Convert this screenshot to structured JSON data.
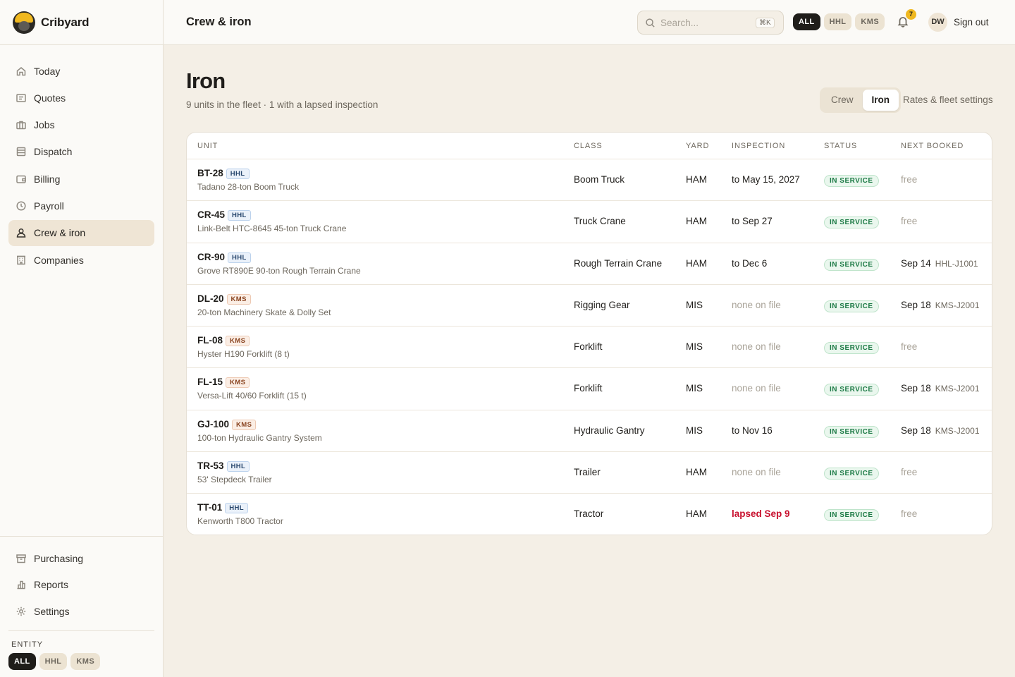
{
  "app": {
    "name": "Cribyard"
  },
  "sidebar": {
    "items": [
      {
        "label": "Today",
        "icon": "home-icon"
      },
      {
        "label": "Quotes",
        "icon": "document-icon"
      },
      {
        "label": "Jobs",
        "icon": "briefcase-icon"
      },
      {
        "label": "Dispatch",
        "icon": "clipboard-icon"
      },
      {
        "label": "Billing",
        "icon": "wallet-icon"
      },
      {
        "label": "Payroll",
        "icon": "clock-icon"
      },
      {
        "label": "Crew & iron",
        "icon": "person-icon",
        "active": true
      },
      {
        "label": "Companies",
        "icon": "building-icon"
      }
    ],
    "bottom_items": [
      {
        "label": "Purchasing",
        "icon": "archive-icon"
      },
      {
        "label": "Reports",
        "icon": "bar-chart-icon"
      },
      {
        "label": "Settings",
        "icon": "gear-icon"
      }
    ],
    "entity_label": "ENTITY",
    "entity_pills": [
      "ALL",
      "HHL",
      "KMS"
    ]
  },
  "header": {
    "title": "Crew & iron",
    "search_placeholder": "Search...",
    "search_shortcut": "⌘K",
    "entity_pills": [
      "ALL",
      "HHL",
      "KMS"
    ],
    "notification_count": "7",
    "avatar_initials": "DW",
    "sign_out": "Sign out"
  },
  "main": {
    "title": "Iron",
    "subtitle": "9 units in the fleet · 1 with a lapsed inspection",
    "tabs": [
      "Crew",
      "Iron"
    ],
    "active_tab": "Iron",
    "settings_link": "Rates & fleet settings"
  },
  "table": {
    "columns": [
      "UNIT",
      "CLASS",
      "YARD",
      "INSPECTION",
      "STATUS",
      "NEXT BOOKED"
    ],
    "rows": [
      {
        "code": "BT-28",
        "entity": "HHL",
        "desc": "Tadano 28-ton Boom Truck",
        "class": "Boom Truck",
        "yard": "HAM",
        "inspection": "to May 15, 2027",
        "inspection_state": "ok",
        "status": "IN SERVICE",
        "next_date": "free",
        "next_job": ""
      },
      {
        "code": "CR-45",
        "entity": "HHL",
        "desc": "Link-Belt HTC-8645 45-ton Truck Crane",
        "class": "Truck Crane",
        "yard": "HAM",
        "inspection": "to Sep 27",
        "inspection_state": "ok",
        "status": "IN SERVICE",
        "next_date": "free",
        "next_job": ""
      },
      {
        "code": "CR-90",
        "entity": "HHL",
        "desc": "Grove RT890E 90-ton Rough Terrain Crane",
        "class": "Rough Terrain Crane",
        "yard": "HAM",
        "inspection": "to Dec 6",
        "inspection_state": "ok",
        "status": "IN SERVICE",
        "next_date": "Sep 14",
        "next_job": "HHL-J1001"
      },
      {
        "code": "DL-20",
        "entity": "KMS",
        "desc": "20-ton Machinery Skate & Dolly Set",
        "class": "Rigging Gear",
        "yard": "MIS",
        "inspection": "none on file",
        "inspection_state": "none",
        "status": "IN SERVICE",
        "next_date": "Sep 18",
        "next_job": "KMS-J2001"
      },
      {
        "code": "FL-08",
        "entity": "KMS",
        "desc": "Hyster H190 Forklift (8 t)",
        "class": "Forklift",
        "yard": "MIS",
        "inspection": "none on file",
        "inspection_state": "none",
        "status": "IN SERVICE",
        "next_date": "free",
        "next_job": ""
      },
      {
        "code": "FL-15",
        "entity": "KMS",
        "desc": "Versa-Lift 40/60 Forklift (15 t)",
        "class": "Forklift",
        "yard": "MIS",
        "inspection": "none on file",
        "inspection_state": "none",
        "status": "IN SERVICE",
        "next_date": "Sep 18",
        "next_job": "KMS-J2001"
      },
      {
        "code": "GJ-100",
        "entity": "KMS",
        "desc": "100-ton Hydraulic Gantry System",
        "class": "Hydraulic Gantry",
        "yard": "MIS",
        "inspection": "to Nov 16",
        "inspection_state": "ok",
        "status": "IN SERVICE",
        "next_date": "Sep 18",
        "next_job": "KMS-J2001"
      },
      {
        "code": "TR-53",
        "entity": "HHL",
        "desc": "53' Stepdeck Trailer",
        "class": "Trailer",
        "yard": "HAM",
        "inspection": "none on file",
        "inspection_state": "none",
        "status": "IN SERVICE",
        "next_date": "free",
        "next_job": ""
      },
      {
        "code": "TT-01",
        "entity": "HHL",
        "desc": "Kenworth T800 Tractor",
        "class": "Tractor",
        "yard": "HAM",
        "inspection": "lapsed Sep 9",
        "inspection_state": "lapsed",
        "status": "IN SERVICE",
        "next_date": "free",
        "next_job": ""
      }
    ]
  },
  "colors": {
    "accent": "#f0b81f",
    "lapsed": "#c8102e",
    "in_service": "#1c7a45",
    "background": "#f4efe6"
  }
}
